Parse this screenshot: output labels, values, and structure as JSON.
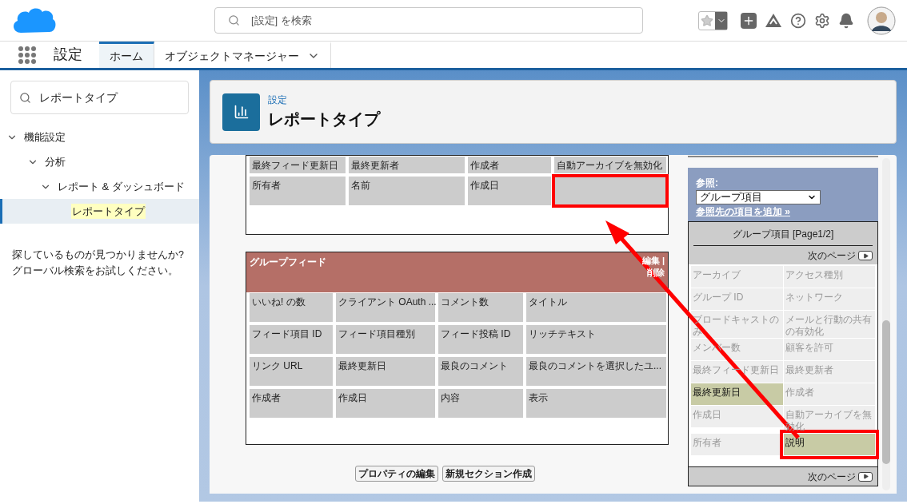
{
  "search": {
    "placeholder": "[設定] を検索"
  },
  "app_name": "設定",
  "tabs": [
    {
      "label": "ホーム",
      "selected": true,
      "kind": "plain"
    },
    {
      "label": "オブジェクトマネージャー",
      "selected": false,
      "kind": "menu"
    }
  ],
  "sidebar": {
    "search_value": "レポートタイプ",
    "tree": [
      {
        "label": "機能設定",
        "expanded": true,
        "selected": false,
        "children": [
          {
            "label": "分析",
            "expanded": true,
            "selected": false,
            "children": [
              {
                "label": "レポート & ダッシュボード",
                "expanded": true,
                "selected": false,
                "children": [
                  {
                    "label": "レポートタイプ",
                    "selected": true
                  }
                ]
              }
            ]
          }
        ]
      }
    ],
    "help": "探しているものが見つかりませんか?\nグローバル検索をお試しください。"
  },
  "page_header": {
    "breadcrumb": "設定",
    "title": "レポートタイプ"
  },
  "sections": [
    {
      "rows": [
        [
          {
            "text": "最終フィード更新日",
            "highlighted": false
          },
          {
            "text": "最終更新者",
            "highlighted": false
          },
          {
            "text": "作成者",
            "highlighted": false
          },
          {
            "text": "自動アーカイブを無効化",
            "highlighted": false
          }
        ],
        [
          {
            "text": "所有者",
            "highlighted": false
          },
          {
            "text": "名前",
            "highlighted": false
          },
          {
            "text": "作成日",
            "highlighted": false
          },
          {
            "highlighted": true
          }
        ]
      ]
    },
    {
      "title": "グループフィード",
      "actions": [
        "編集",
        "削除"
      ],
      "action_separator": "|",
      "rows": [
        [
          {
            "text": "いいね! の数",
            "highlighted": false
          },
          {
            "text": "クライアント OAuth ...",
            "highlighted": false
          },
          {
            "text": "コメント数",
            "highlighted": false
          },
          {
            "text": "タイトル",
            "highlighted": false
          }
        ],
        [
          {
            "text": "フィード項目 ID",
            "highlighted": false
          },
          {
            "text": "フィード項目種別",
            "highlighted": false
          },
          {
            "text": "フィード投稿 ID",
            "highlighted": false
          },
          {
            "text": "リッチテキスト",
            "highlighted": false
          }
        ],
        [
          {
            "text": "リンク URL",
            "highlighted": false
          },
          {
            "text": "最終更新日",
            "highlighted": false
          },
          {
            "text": "最良のコメント",
            "highlighted": false
          },
          {
            "text": "最良のコメントを選択したユ...",
            "highlighted": false
          }
        ],
        [
          {
            "text": "作成者",
            "highlighted": false
          },
          {
            "text": "作成日",
            "highlighted": false
          },
          {
            "text": "内容",
            "highlighted": false
          },
          {
            "text": "表示",
            "highlighted": false
          }
        ]
      ]
    }
  ],
  "buttons": [
    "プロパティの編集",
    "新規セクション作成"
  ],
  "reference": {
    "label": "参照:",
    "value": "グループ項目",
    "add_link": "参照先の項目を追加 »"
  },
  "field_list": {
    "title": "グループ項目",
    "page": "[Page1/2]",
    "next_top": "次のページ",
    "next_bottom": "次のページ",
    "fields": [
      {
        "label": "アーカイブ",
        "placed": true,
        "highlighted": false
      },
      {
        "label": "アクセス種別",
        "placed": true,
        "highlighted": false
      },
      {
        "label": "グループ ID",
        "placed": true,
        "highlighted": false
      },
      {
        "label": "ネットワーク",
        "placed": true,
        "highlighted": false
      },
      {
        "label": "ブロードキャストのみ",
        "placed": true,
        "highlighted": false
      },
      {
        "label": "メールと行動の共有の有効化",
        "placed": true,
        "highlighted": false
      },
      {
        "label": "メンバー数",
        "placed": true,
        "highlighted": false
      },
      {
        "label": "顧客を許可",
        "placed": true,
        "highlighted": false
      },
      {
        "label": "最終フィード更新日",
        "placed": true,
        "highlighted": false
      },
      {
        "label": "最終更新者",
        "placed": true,
        "highlighted": false
      },
      {
        "label": "最終更新日",
        "placed": false,
        "highlighted": false
      },
      {
        "label": "作成者",
        "placed": true,
        "highlighted": false
      },
      {
        "label": "作成日",
        "placed": true,
        "highlighted": false
      },
      {
        "label": "自動アーカイブを無効化",
        "placed": true,
        "highlighted": false
      },
      {
        "label": "所有者",
        "placed": true,
        "highlighted": false
      },
      {
        "label": "説明",
        "placed": false,
        "highlighted": true
      }
    ]
  },
  "annotation_arrow": true
}
